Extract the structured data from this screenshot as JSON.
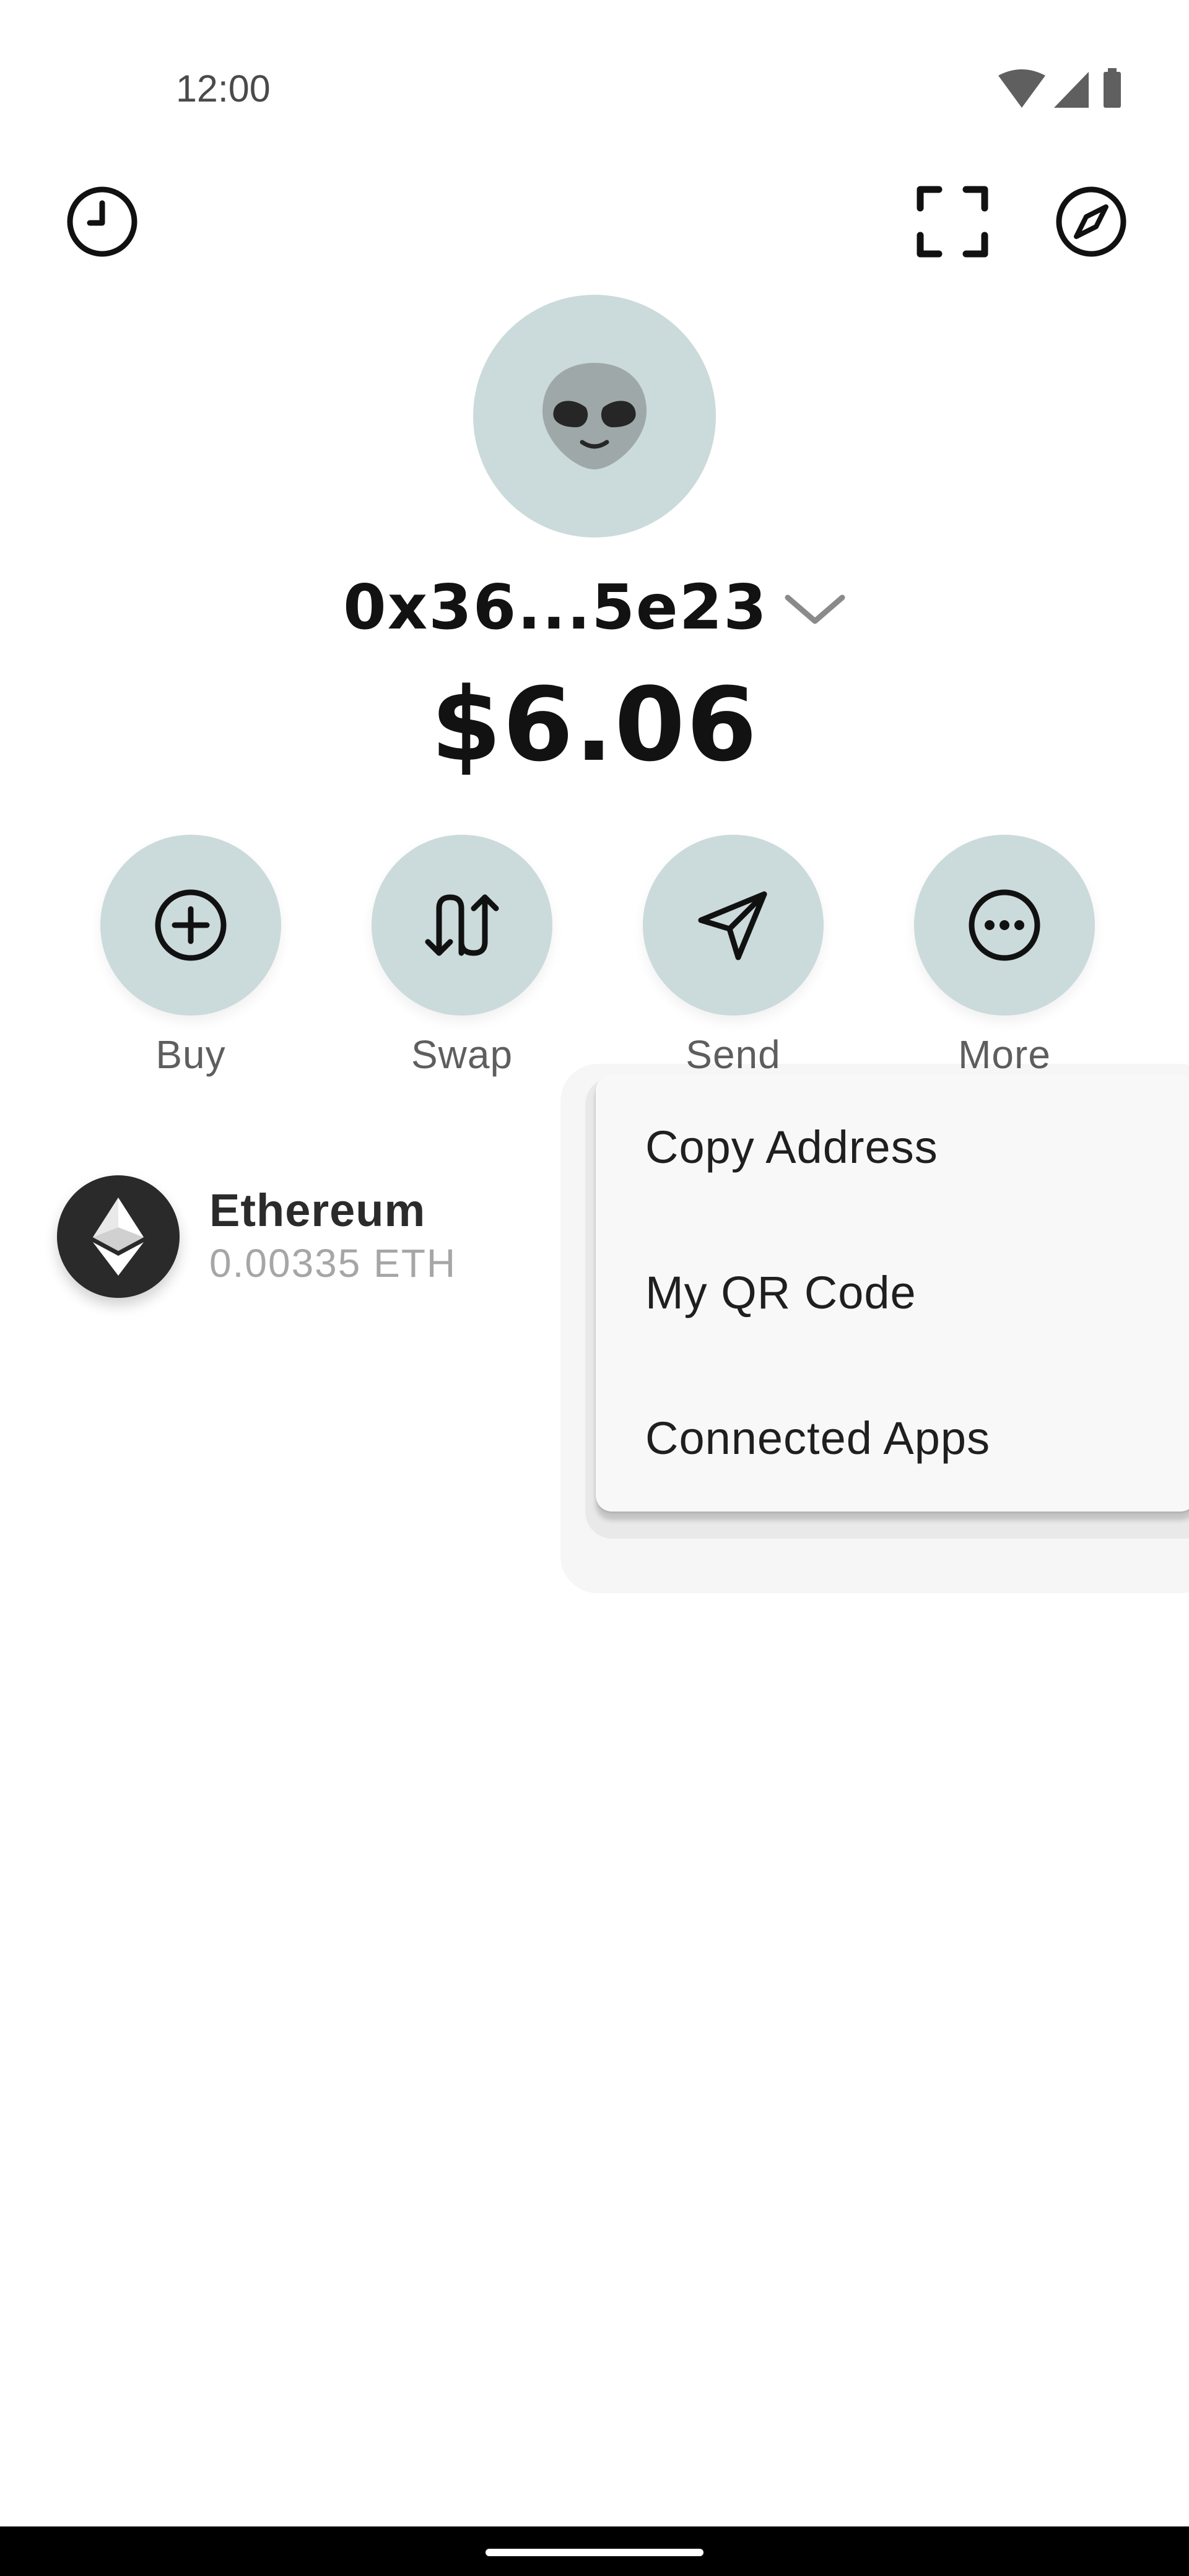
{
  "status_bar": {
    "time": "12:00",
    "icons": [
      "wifi-icon",
      "cellular-signal-icon",
      "battery-icon"
    ]
  },
  "top_bar": {
    "left_icon": "history-clock-icon",
    "right_icons": [
      "scan-qr-icon",
      "compass-explore-icon"
    ]
  },
  "wallet": {
    "avatar_emoji": "👽",
    "address": "0x36...5e23",
    "balance": "$6.06"
  },
  "actions": [
    {
      "label": "Buy",
      "icon": "plus-circle-icon"
    },
    {
      "label": "Swap",
      "icon": "swap-arrows-icon"
    },
    {
      "label": "Send",
      "icon": "send-paper-plane-icon"
    },
    {
      "label": "More",
      "icon": "more-dots-icon"
    }
  ],
  "tokens": [
    {
      "name": "Ethereum",
      "amount": "0.00335 ETH",
      "icon": "ethereum-logo-icon"
    }
  ],
  "menu": {
    "items": [
      "Copy Address",
      "My QR Code",
      "Connected Apps"
    ]
  },
  "colors": {
    "accent_circle": "#cbdada",
    "text_primary": "#121212",
    "text_secondary": "#a6a6a6",
    "menu_background": "#f8f8f8"
  }
}
